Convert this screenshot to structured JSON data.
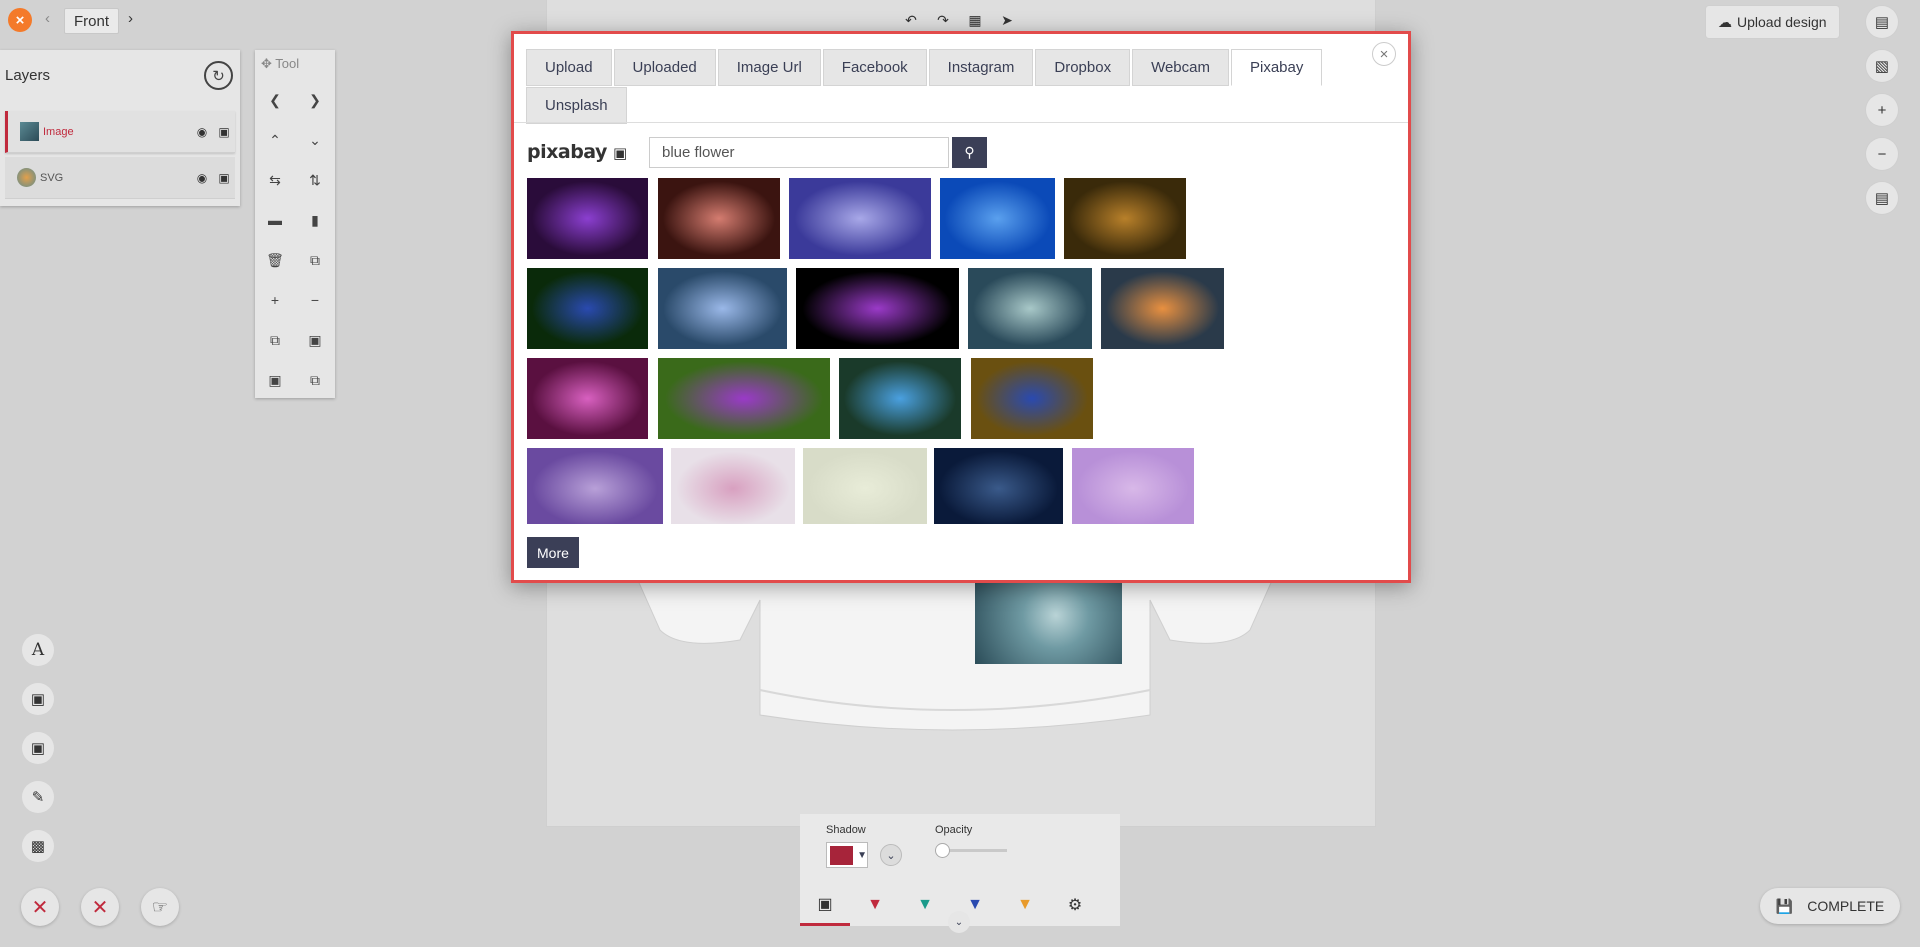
{
  "topbar": {
    "front_label": "Front",
    "upload_design_label": "Upload design",
    "close_icon": "×"
  },
  "layers": {
    "title": "Layers",
    "items": [
      {
        "name": "Image",
        "active": true
      },
      {
        "name": "SVG",
        "active": false
      }
    ]
  },
  "tool": {
    "title": "Tool"
  },
  "modal": {
    "tabs": [
      "Upload",
      "Uploaded",
      "Image Url",
      "Facebook",
      "Instagram",
      "Dropbox",
      "Webcam",
      "Pixabay",
      "Unsplash"
    ],
    "active_tab": "Pixabay",
    "logo_text": "pixabay",
    "search_value": "blue flower",
    "more_label": "More",
    "close_label": "×"
  },
  "gallery": {
    "images": [
      {
        "name": "purple-geranium-flowers",
        "colors": [
          "#2a0c3a",
          "#8b3fd0",
          "#1a2a10"
        ]
      },
      {
        "name": "woman-with-flowers",
        "colors": [
          "#3b1410",
          "#d47c70",
          "#3b3a10"
        ]
      },
      {
        "name": "butterfly-on-purple-petal",
        "colors": [
          "#3b3a9a",
          "#a8a8e8",
          "#6a6ac8"
        ]
      },
      {
        "name": "red-white-tulips-blue-sky",
        "colors": [
          "#0b4ab8",
          "#5aa0ee",
          "#c02020"
        ]
      },
      {
        "name": "blue-cornflowers-bokeh",
        "colors": [
          "#3a2a0a",
          "#b8802a",
          "#2a48b0"
        ]
      },
      {
        "name": "forget-me-nots-field",
        "colors": [
          "#0a2a0a",
          "#2a4ab0",
          "#3a6a2a"
        ]
      },
      {
        "name": "bee-on-forget-me-nots",
        "colors": [
          "#2a4a6a",
          "#9ab8e8",
          "#d8c8a0"
        ]
      },
      {
        "name": "purple-water-lily-black",
        "colors": [
          "#000000",
          "#9a3ac8",
          "#000000"
        ]
      },
      {
        "name": "white-daffodil-teal",
        "colors": [
          "#2a4a5a",
          "#a8c8c8",
          "#1a3040"
        ]
      },
      {
        "name": "blue-flowers-sunset",
        "colors": [
          "#2a3a4a",
          "#e89040",
          "#3a4a5a"
        ]
      },
      {
        "name": "pink-phlox-flowers",
        "colors": [
          "#5a1040",
          "#d860c0",
          "#3a6a2a"
        ]
      },
      {
        "name": "purple-lotus-green",
        "colors": [
          "#3a6a1a",
          "#9a3ac8",
          "#5a8a2a"
        ]
      },
      {
        "name": "blue-forget-me-not-closeup",
        "colors": [
          "#1a3a2a",
          "#4aa0e0",
          "#2a4a3a"
        ]
      },
      {
        "name": "bluebell-golden-light",
        "colors": [
          "#6a5010",
          "#2a4ab0",
          "#b8902a"
        ]
      },
      {
        "name": "lavender-row",
        "colors": [
          "#6a4aa0",
          "#b8a0d8",
          "#8a7ab8"
        ]
      },
      {
        "name": "white-blossoms",
        "colors": [
          "#e8e0e8",
          "#d8a0c0",
          "#f0f0f0"
        ]
      },
      {
        "name": "pale-bokeh",
        "colors": [
          "#d8dcc8",
          "#e8ecd8",
          "#c8d0b8"
        ]
      },
      {
        "name": "dark-blue-flower",
        "colors": [
          "#0a1a3a",
          "#3a5a8a",
          "#0a1a3a"
        ]
      },
      {
        "name": "lilac-field",
        "colors": [
          "#b890d8",
          "#d8b8e8",
          "#a080c8"
        ]
      }
    ]
  },
  "props": {
    "shadow_label": "Shadow",
    "opacity_label": "Opacity",
    "shadow_color": "#a7243a",
    "opacity_value": 0
  },
  "complete_label": "COMPLETE",
  "accent_color": "#c02a3d",
  "modal_border_color": "#e24b4b"
}
